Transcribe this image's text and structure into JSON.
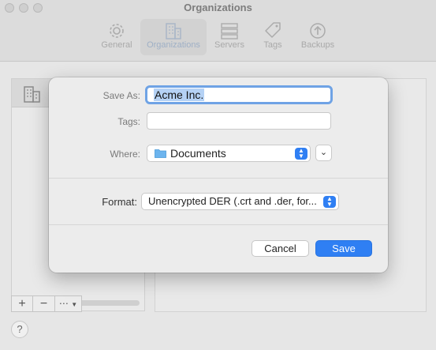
{
  "window": {
    "title": "Organizations"
  },
  "toolbar": {
    "items": [
      {
        "label": "General",
        "icon": "gear-icon"
      },
      {
        "label": "Organizations",
        "icon": "building-icon"
      },
      {
        "label": "Servers",
        "icon": "server-icon"
      },
      {
        "label": "Tags",
        "icon": "tag-icon"
      },
      {
        "label": "Backups",
        "icon": "backup-arrow-icon"
      }
    ],
    "active": "Organizations"
  },
  "sidebar_tools": {
    "add": "+",
    "remove": "−",
    "more": "⋯"
  },
  "help": "?",
  "save_sheet": {
    "save_as_label": "Save As:",
    "save_as_value": "Acme Inc.",
    "tags_label": "Tags:",
    "tags_value": "",
    "where_label": "Where:",
    "where_value": "Documents",
    "format_label": "Format:",
    "format_value": "Unencrypted DER (.crt and .der, for...",
    "cancel_label": "Cancel",
    "save_label": "Save"
  },
  "colors": {
    "accent": "#2f7ff3",
    "focus_ring": "#6fa3e5",
    "selection": "#b5d2f5"
  }
}
